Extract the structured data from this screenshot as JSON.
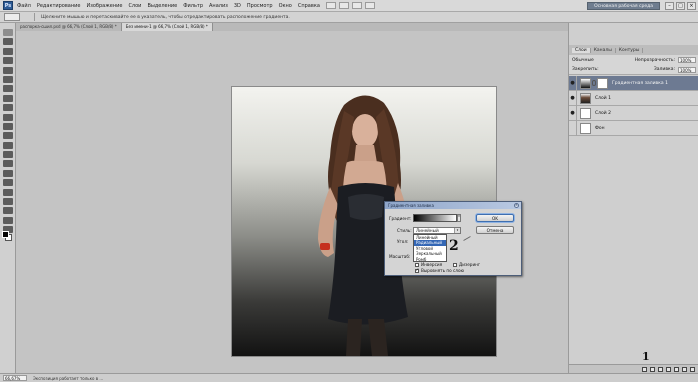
{
  "menubar": {
    "logo": "Ps",
    "items": [
      "Файл",
      "Редактирование",
      "Изображение",
      "Слои",
      "Выделение",
      "Фильтр",
      "Анализ",
      "3D",
      "Просмотр",
      "Окно",
      "Справка"
    ],
    "workspace_button": "Основная рабочая среда"
  },
  "options_bar": {
    "hint": "Щелкните мышью и перетаскивайте ее в указатель, чтобы отредактировать расположение градиента."
  },
  "tabs": [
    {
      "label": "распорка-сшил.psd @ 66,7% (Слой 1, RGB/8) *"
    },
    {
      "label": "Без имени-1 @ 66,7% (Слой 1, RGB/8) *"
    }
  ],
  "status": {
    "zoom": "66,67%",
    "text": "Экспозиция работает только в ..."
  },
  "layers_panel": {
    "tabs": [
      "Слои",
      "Каналы",
      "Контуры"
    ],
    "blend_mode": "Обычные",
    "opacity_label": "Непрозрачность:",
    "opacity_value": "100%",
    "lock_label": "Закрепить:",
    "fill_label": "Заливка:",
    "fill_value": "100%",
    "layers": [
      {
        "name": "Градиентная заливка 1",
        "selected": true
      },
      {
        "name": "Слой 1",
        "selected": false
      },
      {
        "name": "Слой 2",
        "selected": false
      },
      {
        "name": "Фон",
        "selected": false
      }
    ]
  },
  "dialog": {
    "title": "Градиентная заливка",
    "gradient_label": "Градиент:",
    "style_label": "Стиль:",
    "style_value": "Линейный",
    "angle_label": "Угол:",
    "scale_label": "Масштаб:",
    "ok": "OK",
    "cancel": "Отмена",
    "style_options": [
      "Линейный",
      "Радиальный",
      "Угловой",
      "Зеркальный",
      "Ромб"
    ],
    "highlighted_option_index": 1,
    "reverse_label": "Инверсия",
    "dither_label": "Дизеринг",
    "align_label": "Выровнять по слою"
  },
  "annotations": {
    "step1": "1",
    "step2": "2"
  }
}
